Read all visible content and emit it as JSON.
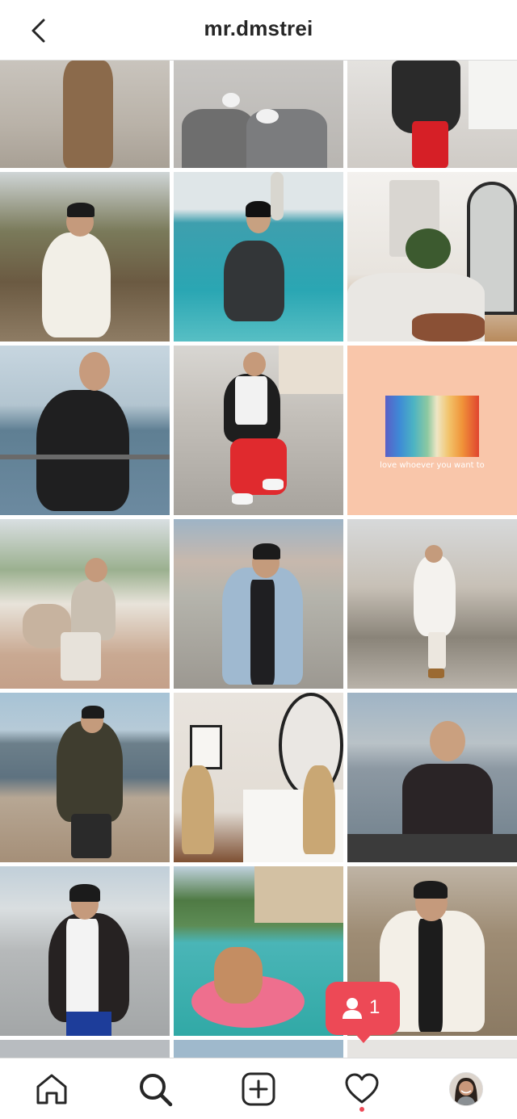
{
  "header": {
    "title": "mr.dmstrei",
    "back_icon": "chevron-left-icon"
  },
  "grid": {
    "rainbow_post_caption": "love whoever you want to"
  },
  "notification": {
    "icon": "person-icon",
    "count": "1",
    "color": "#ed4956"
  },
  "tabbar": {
    "items": [
      "home-icon",
      "search-icon",
      "add-post-icon",
      "activity-heart-icon",
      "profile-avatar"
    ],
    "active": "search",
    "accent": "#ed4956"
  }
}
